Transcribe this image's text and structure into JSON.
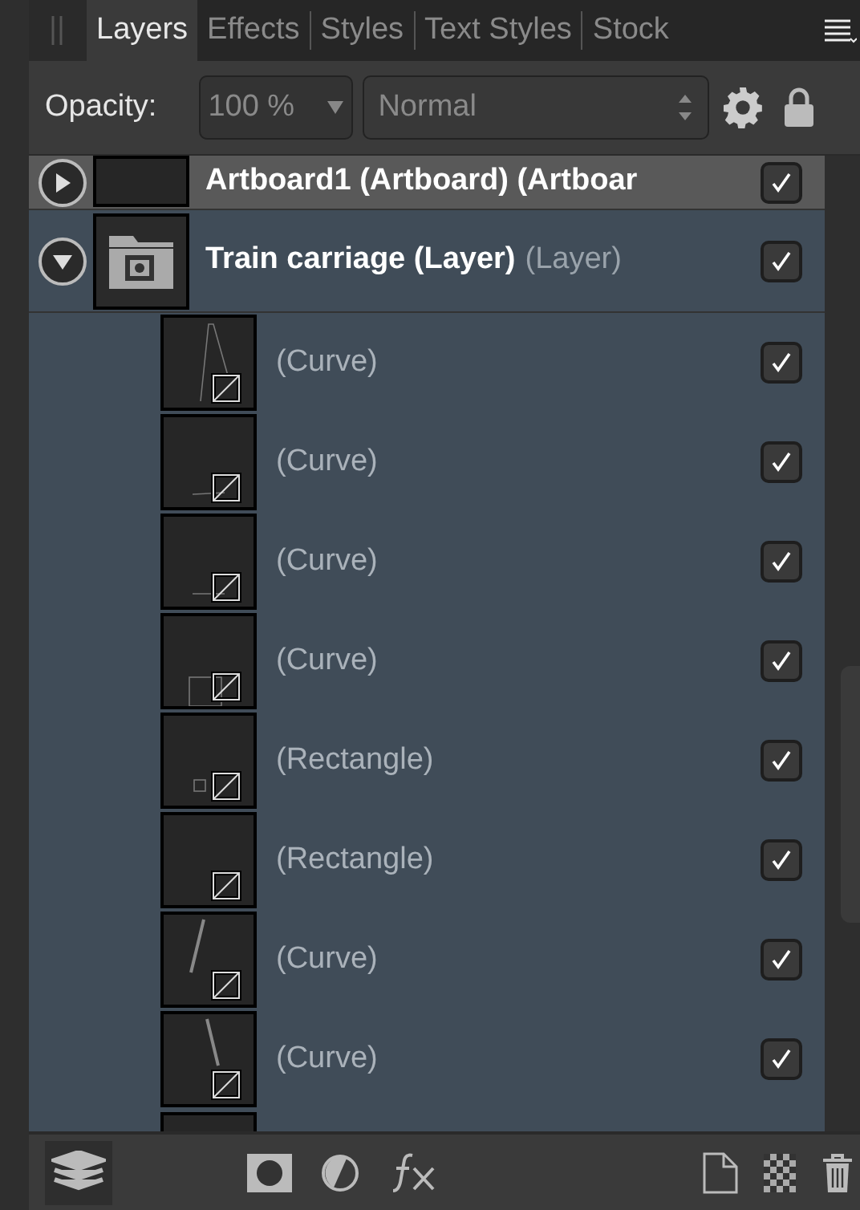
{
  "tabs": [
    {
      "label": "Layers",
      "selected": true
    },
    {
      "label": "Effects",
      "selected": false
    },
    {
      "label": "Styles",
      "selected": false
    },
    {
      "label": "Text Styles",
      "selected": false
    },
    {
      "label": "Stock",
      "selected": false
    }
  ],
  "toolbar": {
    "opacity_label": "Opacity:",
    "opacity_value": "100 %",
    "blend_mode": "Normal"
  },
  "layers": [
    {
      "name": "Artboard1 (Artboard) (Artboar",
      "expanded": false,
      "visible": true,
      "selected": false,
      "kind": "artboard"
    },
    {
      "name": "Train carriage (Layer)",
      "type_label": "(Layer)",
      "expanded": true,
      "visible": true,
      "selected": true,
      "kind": "layer",
      "children": [
        {
          "name": "(Curve)",
          "visible": true
        },
        {
          "name": "(Curve)",
          "visible": true
        },
        {
          "name": "(Curve)",
          "visible": true
        },
        {
          "name": "(Curve)",
          "visible": true
        },
        {
          "name": "(Rectangle)",
          "visible": true
        },
        {
          "name": "(Rectangle)",
          "visible": true
        },
        {
          "name": "(Curve)",
          "visible": true
        },
        {
          "name": "(Curve)",
          "visible": true
        }
      ]
    }
  ]
}
